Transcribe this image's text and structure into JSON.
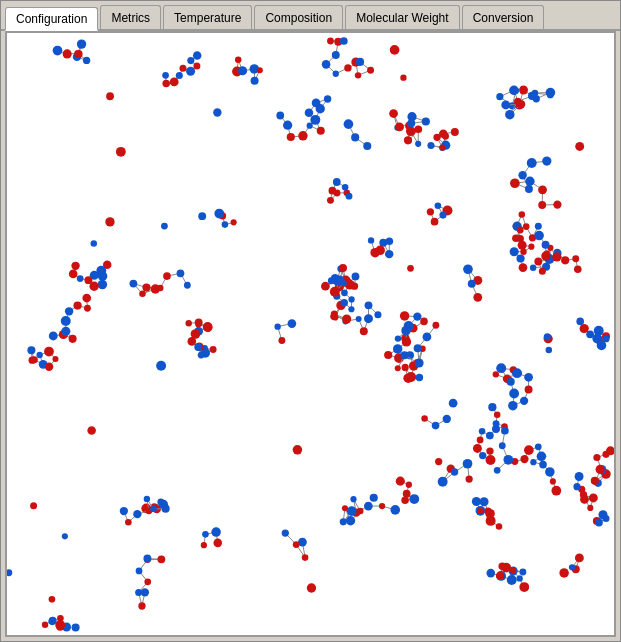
{
  "tabs": [
    {
      "label": "Configuration",
      "active": true
    },
    {
      "label": "Metrics",
      "active": false
    },
    {
      "label": "Temperature",
      "active": false
    },
    {
      "label": "Composition",
      "active": false
    },
    {
      "label": "Molecular Weight",
      "active": false
    },
    {
      "label": "Conversion",
      "active": false
    }
  ],
  "particles": {
    "blue_color": "#1a1aff",
    "red_color": "#cc0000",
    "description": "Polymer chain simulation showing blue and red monomers connected in chains"
  }
}
